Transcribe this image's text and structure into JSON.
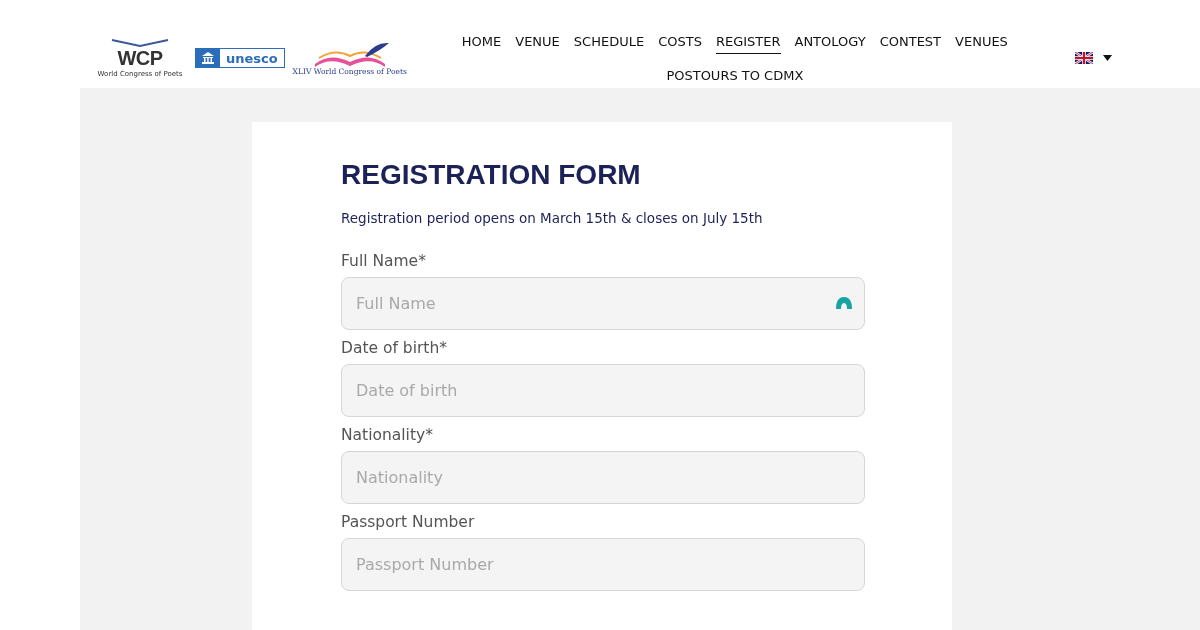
{
  "logos": {
    "wcp": {
      "mark": "WCP",
      "caption": "World Congress of Poets"
    },
    "unesco": {
      "name": "unesco"
    },
    "congress": {
      "title": "XLIV World Congress of Poets"
    }
  },
  "nav": [
    {
      "label": "HOME",
      "selected": false
    },
    {
      "label": "VENUE",
      "selected": false
    },
    {
      "label": "SCHEDULE",
      "selected": false
    },
    {
      "label": "COSTS",
      "selected": false
    },
    {
      "label": "REGISTER",
      "selected": true
    },
    {
      "label": "ANTOLOGY",
      "selected": false
    },
    {
      "label": "CONTEST",
      "selected": false
    },
    {
      "label": "VENUES",
      "selected": false
    },
    {
      "label": "POSTOURS TO CDMX",
      "selected": false
    }
  ],
  "form": {
    "title": "REGISTRATION FORM",
    "subtitle": "Registration period opens on March 15th & closes on July 15th",
    "fields": [
      {
        "label": "Full Name*",
        "placeholder": "Full Name",
        "autofill_icon": true
      },
      {
        "label": "Date of birth*",
        "placeholder": "Date of birth",
        "autofill_icon": false
      },
      {
        "label": "Nationality*",
        "placeholder": "Nationality",
        "autofill_icon": false
      },
      {
        "label": "Passport Number",
        "placeholder": "Passport Number",
        "autofill_icon": false
      }
    ]
  }
}
